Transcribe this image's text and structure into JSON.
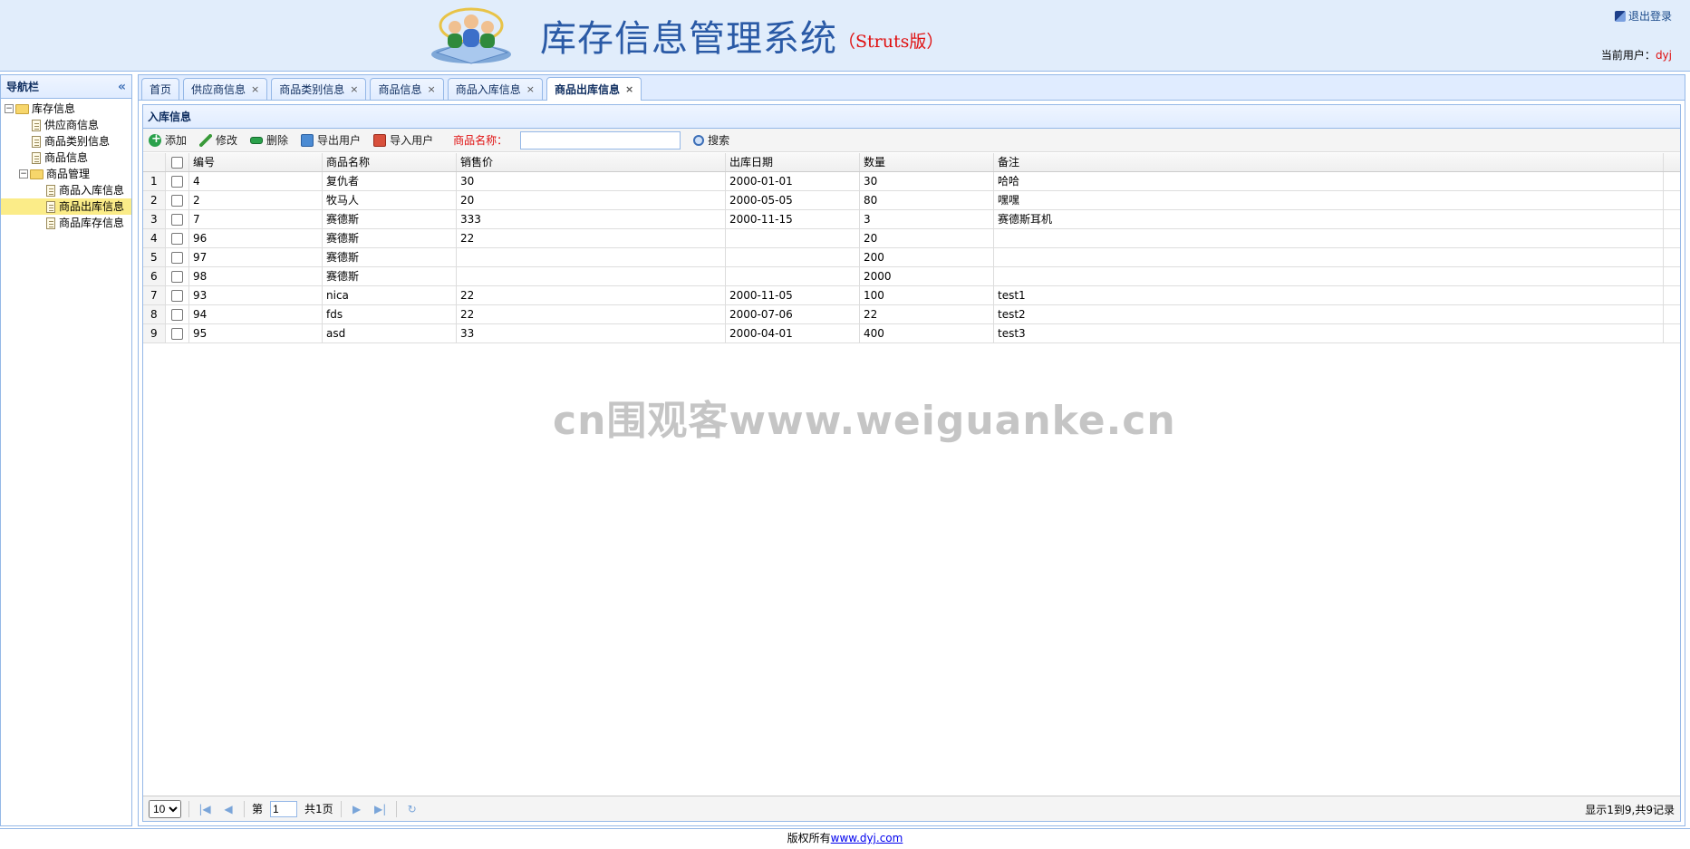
{
  "header": {
    "title": "库存信息管理系统",
    "subtitle": "（Struts版）",
    "logout_label": "退出登录",
    "current_user_label": "当前用户：",
    "current_user": "dyj"
  },
  "nav": {
    "title": "导航栏",
    "tree": {
      "root1": "库存信息",
      "supplier": "供应商信息",
      "category": "商品类别信息",
      "goods": "商品信息",
      "root2": "商品管理",
      "instock": "商品入库信息",
      "outstock": "商品出库信息",
      "stock": "商品库存信息"
    }
  },
  "tabs": [
    "首页",
    "供应商信息",
    "商品类别信息",
    "商品信息",
    "商品入库信息",
    "商品出库信息"
  ],
  "panel": {
    "title": "入库信息",
    "toolbar": {
      "add": "添加",
      "edit": "修改",
      "delete": "删除",
      "export": "导出用户",
      "import": "导入用户",
      "search_label": "商品名称：",
      "search_value": "",
      "search_btn": "搜索"
    },
    "columns": [
      "编号",
      "商品名称",
      "销售价",
      "出库日期",
      "数量",
      "备注"
    ],
    "rows": [
      [
        "1",
        "4",
        "复仇者",
        "30",
        "2000-01-01",
        "30",
        "哈哈"
      ],
      [
        "2",
        "2",
        "牧马人",
        "20",
        "2000-05-05",
        "80",
        "嘿嘿"
      ],
      [
        "3",
        "7",
        "赛德斯",
        "333",
        "2000-11-15",
        "3",
        "赛德斯耳机"
      ],
      [
        "4",
        "96",
        "赛德斯",
        "22",
        "",
        "20",
        ""
      ],
      [
        "5",
        "97",
        "赛德斯",
        "",
        "",
        "200",
        ""
      ],
      [
        "6",
        "98",
        "赛德斯",
        "",
        "",
        "2000",
        ""
      ],
      [
        "7",
        "93",
        "nica",
        "22",
        "2000-11-05",
        "100",
        "test1"
      ],
      [
        "8",
        "94",
        "fds",
        "22",
        "2000-07-06",
        "22",
        "test2"
      ],
      [
        "9",
        "95",
        "asd",
        "33",
        "2000-04-01",
        "400",
        "test3"
      ]
    ],
    "pager": {
      "page_size": "10",
      "page_prefix": "第",
      "page_value": "1",
      "page_total": "共1页",
      "info": "显示1到9,共9记录"
    }
  },
  "watermark": "cn围观客www.weiguanke.cn",
  "footer": {
    "text": "版权所有",
    "link": "www.dyj.com"
  }
}
